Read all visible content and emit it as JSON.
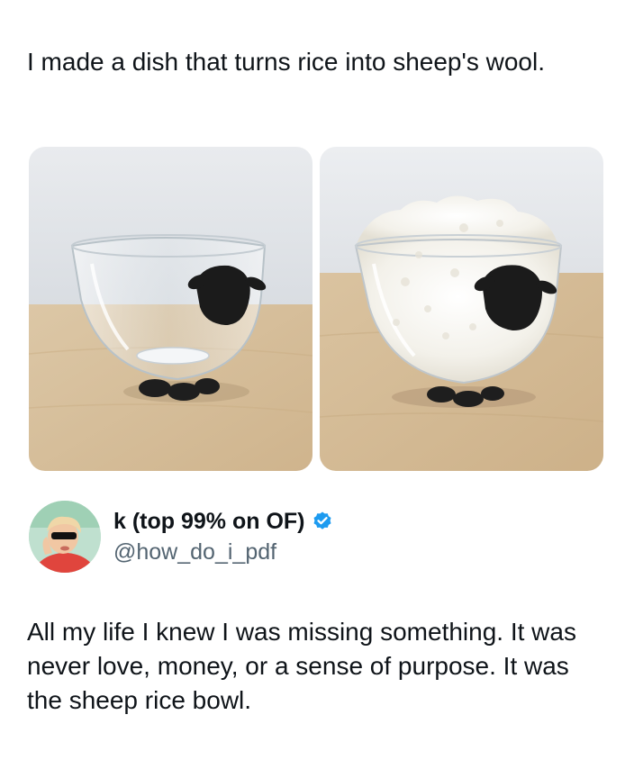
{
  "caption": "I made a dish that turns rice into sheep's wool.",
  "photos": [
    {
      "icon": "empty-sheep-bowl-image"
    },
    {
      "icon": "rice-filled-sheep-bowl-image"
    }
  ],
  "tweet": {
    "display_name": "k (top 99% on OF)",
    "handle": "@how_do_i_pdf",
    "verified_icon": "verified-badge-icon",
    "avatar_icon": "avatar-image",
    "text": "All my life I knew I was missing something. It was never love, money, or a sense of purpose. It was the sheep rice bowl."
  },
  "colors": {
    "verified_blue": "#1d9bf0",
    "handle_gray": "#536471",
    "text_dark": "#0f1419"
  }
}
